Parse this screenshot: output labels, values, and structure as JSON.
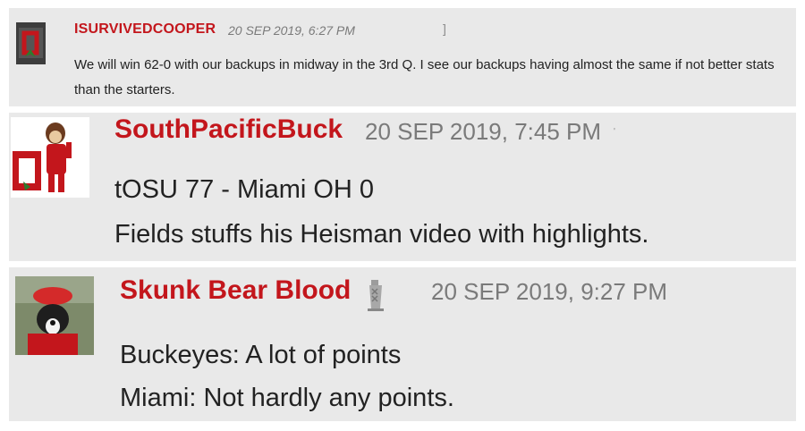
{
  "comments": [
    {
      "username": "ISURVIVEDCOOPER",
      "timestamp": "20 SEP 2019, 6:27 PM",
      "mark": "]",
      "lines": [
        "We will win 62-0 with our backups in midway in the 3rd Q. I see our backups having almost the same if not better stats",
        "than the starters."
      ],
      "avatar_icon": "ohio-state-logo-icon"
    },
    {
      "username": "SouthPacificBuck",
      "timestamp": "20 SEP 2019, 7:45 PM",
      "mark": "'",
      "lines": [
        "tOSU 77 - Miami OH 0",
        "Fields stuffs his Heisman video with highlights."
      ],
      "avatar_icon": "brutus-buckeye-mascot-icon"
    },
    {
      "username": "Skunk Bear Blood",
      "timestamp": "20 SEP 2019, 9:27 PM",
      "lines": [
        "Buckeyes:  A lot of points",
        "Miami: Not hardly any points."
      ],
      "avatar_icon": "dog-in-red-hat-icon",
      "badge_icon": "tower-badge-icon"
    }
  ],
  "colors": {
    "username": "#c3161c",
    "card_background": "#e9e9e9",
    "timestamp": "#7a7a7a",
    "text": "#222222"
  }
}
